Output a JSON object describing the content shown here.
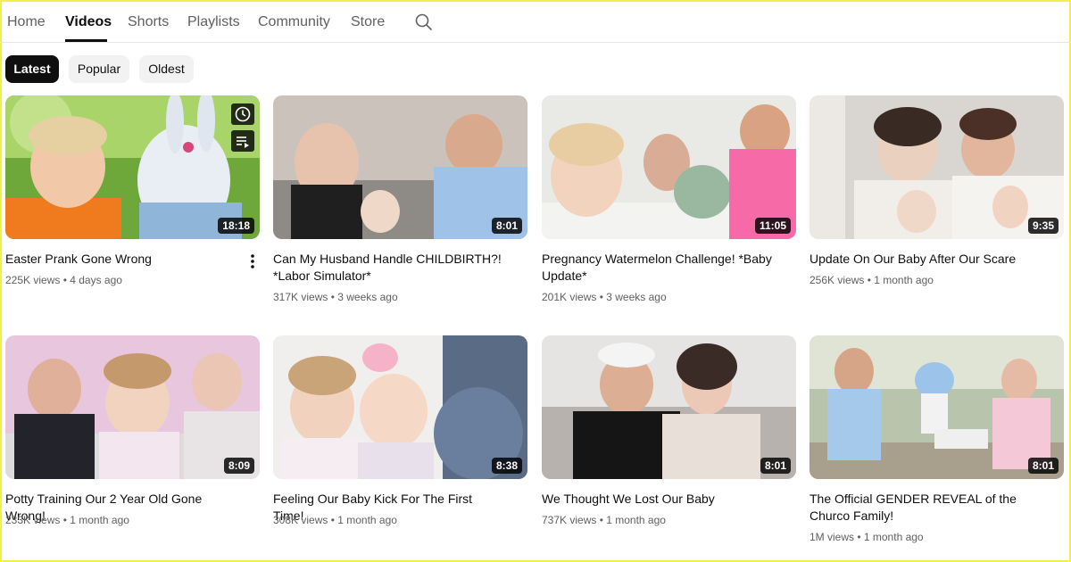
{
  "tabs": [
    "Home",
    "Videos",
    "Shorts",
    "Playlists",
    "Community",
    "Store"
  ],
  "filters": [
    "Latest",
    "Popular",
    "Oldest"
  ],
  "videos": [
    {
      "title": "Easter Prank Gone Wrong",
      "meta": "225K views • 4 days ago",
      "duration": "18:18"
    },
    {
      "title": "Can My Husband Handle CHILDBIRTH?! *Labor Simulator*",
      "meta": "317K views • 3 weeks ago",
      "duration": "8:01"
    },
    {
      "title": "Pregnancy Watermelon Challenge! *Baby Update*",
      "meta": "201K views • 3 weeks ago",
      "duration": "11:05"
    },
    {
      "title": "Update On Our Baby After Our Scare",
      "meta": "256K views • 1 month ago",
      "duration": "9:35"
    },
    {
      "title": "Potty Training Our 2 Year Old Gone Wrong!",
      "meta": "233K views • 1 month ago",
      "duration": "8:09"
    },
    {
      "title": "Feeling Our Baby Kick For The First Time!",
      "meta": "308K views • 1 month ago",
      "duration": "8:38"
    },
    {
      "title": "We Thought We Lost Our Baby",
      "meta": "737K views • 1 month ago",
      "duration": "8:01"
    },
    {
      "title": "The Official GENDER REVEAL of the Churco Family!",
      "meta": "1M views • 1 month ago",
      "duration": "8:01"
    }
  ],
  "icons": {
    "search": "search-icon",
    "watch_later": "clock-icon",
    "add_to_queue": "queue-icon",
    "more": "more-vert-icon"
  },
  "colors": {
    "active_text": "#0f0f0f",
    "inactive_text": "#606060",
    "chip_bg": "#f2f2f2",
    "chip_active_bg": "#0f0f0f"
  }
}
